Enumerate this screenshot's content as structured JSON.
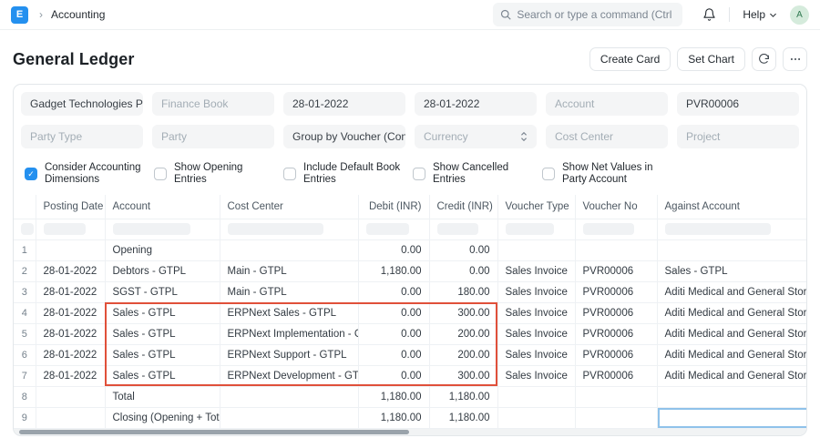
{
  "navbar": {
    "logo_letter": "E",
    "breadcrumb": "Accounting",
    "search": {
      "placeholder": "Search or type a command (Ctrl + G)"
    },
    "help_label": "Help",
    "avatar_letter": "A"
  },
  "page": {
    "title": "General Ledger",
    "actions": {
      "create_card": "Create Card",
      "set_chart": "Set Chart"
    }
  },
  "filters": {
    "row1": [
      {
        "name": "company-filter",
        "value": "Gadget Technologies Pvt.",
        "filled": true
      },
      {
        "name": "finance-book-filter",
        "value": "Finance Book",
        "filled": false
      },
      {
        "name": "from-date-filter",
        "value": "28-01-2022",
        "filled": true
      },
      {
        "name": "to-date-filter",
        "value": "28-01-2022",
        "filled": true
      },
      {
        "name": "account-filter",
        "value": "Account",
        "filled": false
      },
      {
        "name": "voucher-no-filter",
        "value": "PVR00006",
        "filled": true
      }
    ],
    "row2": [
      {
        "name": "party-type-filter",
        "value": "Party Type",
        "filled": false
      },
      {
        "name": "party-filter",
        "value": "Party",
        "filled": false
      },
      {
        "name": "group-by-filter",
        "value": "Group by Voucher (Consol",
        "filled": true
      },
      {
        "name": "currency-filter",
        "value": "Currency",
        "filled": false,
        "select": true
      },
      {
        "name": "cost-center-filter",
        "value": "Cost Center",
        "filled": false
      },
      {
        "name": "project-filter",
        "value": "Project",
        "filled": false
      }
    ]
  },
  "checkboxes": [
    {
      "label": "Consider Accounting Dimensions",
      "checked": true
    },
    {
      "label": "Show Opening Entries",
      "checked": false
    },
    {
      "label": "Include Default Book Entries",
      "checked": false
    },
    {
      "label": "Show Cancelled Entries",
      "checked": false
    },
    {
      "label": "Show Net Values in Party Account",
      "checked": false
    }
  ],
  "table": {
    "headers": [
      "",
      "Posting Date",
      "Account",
      "Cost Center",
      "Debit (INR)",
      "Credit (INR)",
      "Voucher Type",
      "Voucher No",
      "Against Account"
    ],
    "rows": [
      {
        "n": "1",
        "posting_date": "",
        "account": "Opening",
        "cost_center": "",
        "debit": "0.00",
        "credit": "0.00",
        "voucher_type": "",
        "voucher_no": "",
        "against": ""
      },
      {
        "n": "2",
        "posting_date": "28-01-2022",
        "account": "Debtors - GTPL",
        "cost_center": "Main - GTPL",
        "debit": "1,180.00",
        "credit": "0.00",
        "voucher_type": "Sales Invoice",
        "voucher_no": "PVR00006",
        "against": "Sales - GTPL"
      },
      {
        "n": "3",
        "posting_date": "28-01-2022",
        "account": "SGST - GTPL",
        "cost_center": "Main - GTPL",
        "debit": "0.00",
        "credit": "180.00",
        "voucher_type": "Sales Invoice",
        "voucher_no": "PVR00006",
        "against": "Aditi Medical and General Stores"
      },
      {
        "n": "4",
        "posting_date": "28-01-2022",
        "account": "Sales - GTPL",
        "cost_center": "ERPNext Sales - GTPL",
        "debit": "0.00",
        "credit": "300.00",
        "voucher_type": "Sales Invoice",
        "voucher_no": "PVR00006",
        "against": "Aditi Medical and General Stores"
      },
      {
        "n": "5",
        "posting_date": "28-01-2022",
        "account": "Sales - GTPL",
        "cost_center": "ERPNext Implementation - GTPL",
        "debit": "0.00",
        "credit": "200.00",
        "voucher_type": "Sales Invoice",
        "voucher_no": "PVR00006",
        "against": "Aditi Medical and General Stores"
      },
      {
        "n": "6",
        "posting_date": "28-01-2022",
        "account": "Sales - GTPL",
        "cost_center": "ERPNext Support - GTPL",
        "debit": "0.00",
        "credit": "200.00",
        "voucher_type": "Sales Invoice",
        "voucher_no": "PVR00006",
        "against": "Aditi Medical and General Stores"
      },
      {
        "n": "7",
        "posting_date": "28-01-2022",
        "account": "Sales - GTPL",
        "cost_center": "ERPNext Development - GTPL",
        "debit": "0.00",
        "credit": "300.00",
        "voucher_type": "Sales Invoice",
        "voucher_no": "PVR00006",
        "against": "Aditi Medical and General Stores"
      },
      {
        "n": "8",
        "posting_date": "",
        "account": "Total",
        "cost_center": "",
        "debit": "1,180.00",
        "credit": "1,180.00",
        "voucher_type": "",
        "voucher_no": "",
        "against": ""
      },
      {
        "n": "9",
        "posting_date": "",
        "account": "Closing (Opening + Total)",
        "cost_center": "",
        "debit": "1,180.00",
        "credit": "1,180.00",
        "voucher_type": "",
        "voucher_no": "",
        "against": ""
      }
    ],
    "highlight": {
      "rows": "4-7",
      "columns": "Account through Credit (INR)",
      "color": "#e0503a"
    },
    "selected_cell": {
      "row": 9,
      "column": "Against Account"
    }
  },
  "colors": {
    "accent_blue": "#2490ef",
    "highlight_red": "#e0503a",
    "selected_cell_blue": "#8fc2ea",
    "avatar_bg": "#d5ebdc",
    "input_bg": "#f4f5f6"
  }
}
